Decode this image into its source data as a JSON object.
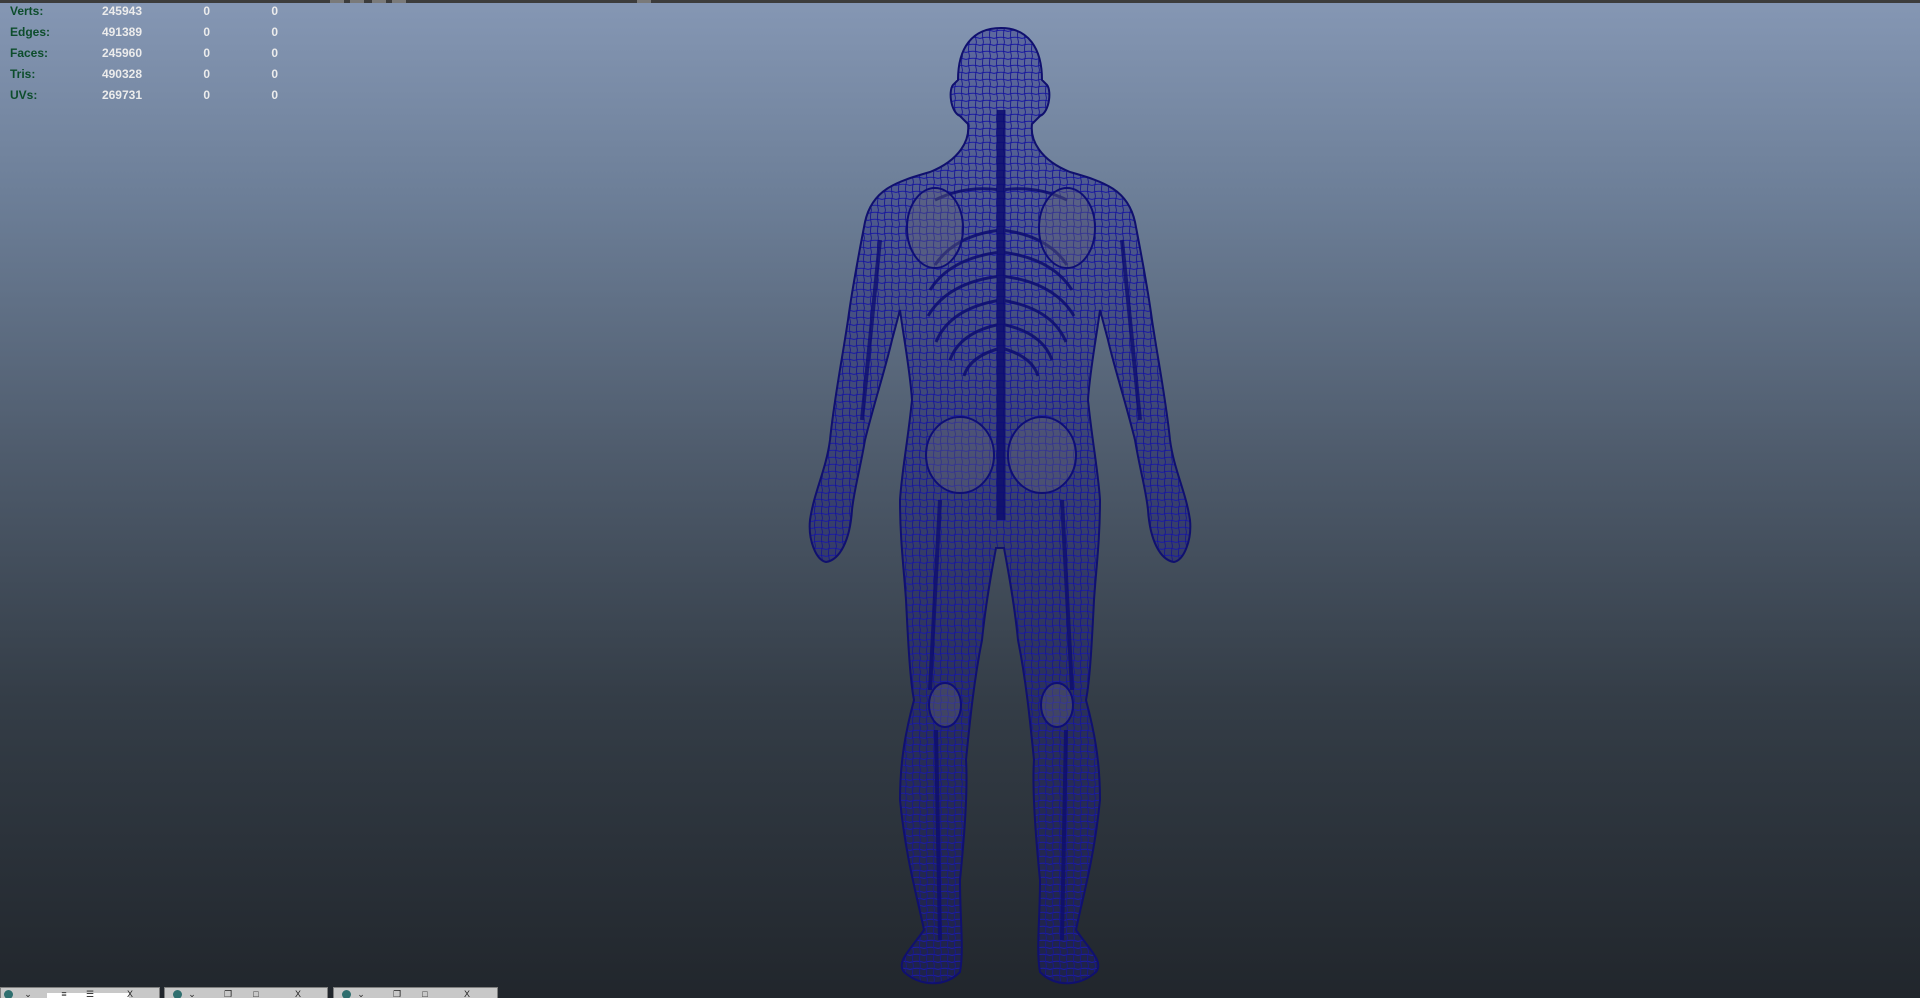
{
  "hud": {
    "rows": [
      {
        "label": "Verts:",
        "total": "245943",
        "selected": "0",
        "component": "0"
      },
      {
        "label": "Edges:",
        "total": "491389",
        "selected": "0",
        "component": "0"
      },
      {
        "label": "Faces:",
        "total": "245960",
        "selected": "0",
        "component": "0"
      },
      {
        "label": "Tris:",
        "total": "490328",
        "selected": "0",
        "component": "0"
      },
      {
        "label": "UVs:",
        "total": "269731",
        "selected": "0",
        "component": "0"
      }
    ]
  },
  "viewport": {
    "background_top": "#8597b4",
    "background_bottom": "#21262c",
    "wireframe_color": "#1a1a9a"
  },
  "taskbar": {
    "groups": [
      {
        "icons": [
          "globe-icon",
          "chevron-icon",
          "list-icon",
          "menu-icon",
          "close-icon"
        ],
        "close_glyph": "X"
      },
      {
        "icons": [
          "globe-icon",
          "chevron-icon",
          "restore-icon",
          "maximize-icon",
          "close-icon"
        ],
        "close_glyph": "X"
      },
      {
        "icons": [
          "globe-icon",
          "chevron-icon",
          "restore-icon",
          "maximize-icon",
          "close-icon"
        ],
        "close_glyph": "X"
      }
    ]
  }
}
